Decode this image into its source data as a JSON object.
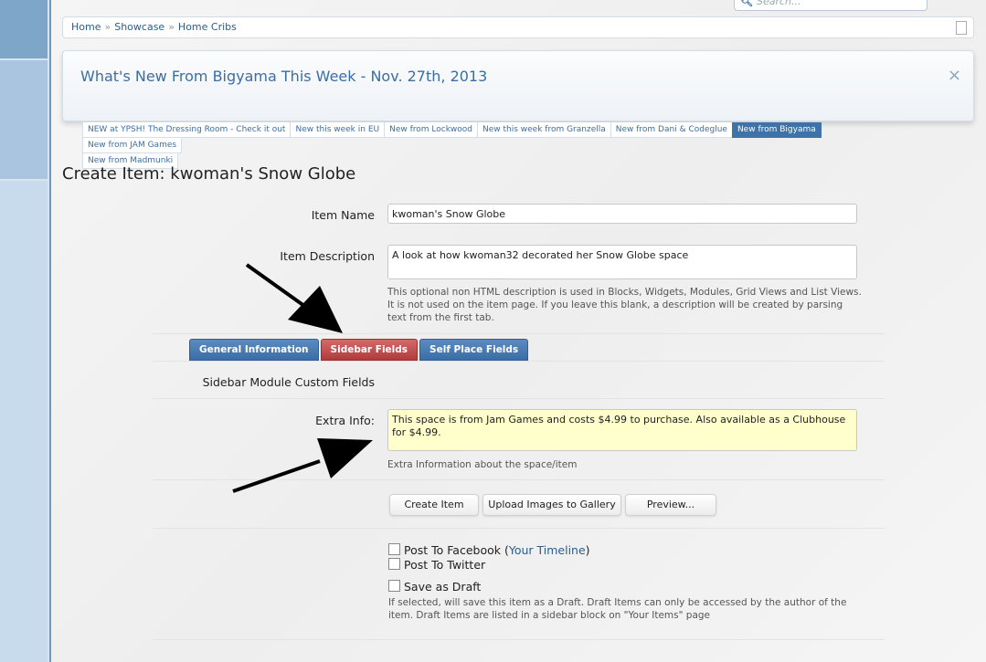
{
  "search": {
    "placeholder": "Search..."
  },
  "breadcrumb": {
    "items": [
      "Home",
      "Showcase",
      "Home Cribs"
    ],
    "separator": "»"
  },
  "notice": {
    "title": "What's New From Bigyama This Week - Nov. 27th, 2013",
    "close": "×"
  },
  "news_tabs": [
    "NEW at YPSH! The Dressing Room - Check it out",
    "New this week in EU",
    "New from Lockwood",
    "New this week from Granzella",
    "New from Dani & Codeglue",
    "New from Bigyama",
    "New from JAM Games",
    "New from Madmunki"
  ],
  "news_tabs_active": "New from Bigyama",
  "page_title": "Create Item: kwoman's Snow Globe",
  "form": {
    "item_name_label": "Item Name",
    "item_name_value": "kwoman's Snow Globe",
    "item_desc_label": "Item Description",
    "item_desc_value": "A look at how kwoman32 decorated her Snow Globe space",
    "item_desc_hint": "This optional non HTML description is used in Blocks, Widgets, Modules, Grid Views and List Views. It is not used on the item page. If you leave this blank, a description will be created by parsing text from the first tab.",
    "tabs": [
      "General Information",
      "Sidebar Fields",
      "Self Place Fields"
    ],
    "active_tab": "Sidebar Fields",
    "section_heading": "Sidebar Module Custom Fields",
    "extra_info_label": "Extra Info:",
    "extra_info_value": "This space is from Jam Games and costs $4.99 to purchase.  Also available as a Clubhouse for $4.99.",
    "extra_info_hint": "Extra Information about the space/item",
    "buttons": {
      "create": "Create Item",
      "upload": "Upload Images to Gallery",
      "preview": "Preview..."
    },
    "post_facebook": "Post To Facebook (",
    "post_facebook_link": "Your Timeline",
    "post_facebook_end": ")",
    "post_twitter": "Post To Twitter",
    "save_draft": "Save as Draft",
    "save_draft_hint": "If selected, will save this item as a Draft. Draft Items can only be accessed by the author of the item. Draft Items are listed in a sidebar block on \"Your Items\" page"
  },
  "colors": {
    "link": "#2b5d8d",
    "tab_blue": "#3b6ea5",
    "tab_red": "#b23b3b",
    "highlight_field": "#ffffcc"
  }
}
